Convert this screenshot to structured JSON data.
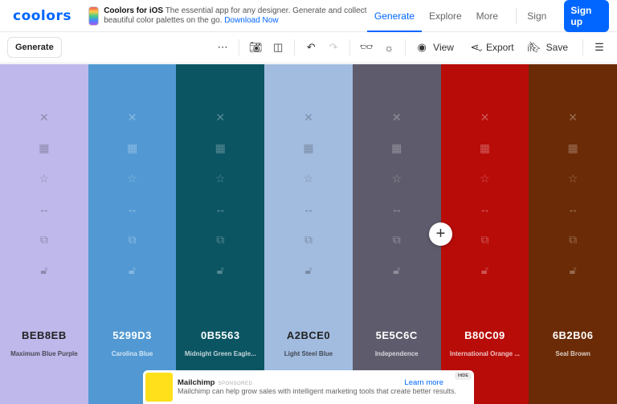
{
  "header": {
    "logo": "coolors",
    "promo_title": "Coolors for iOS",
    "promo_text": "The essential app for any designer. Generate and collect beautiful color palettes on the go.",
    "promo_link": "Download Now",
    "nav": [
      "Generate",
      "Explore",
      "More"
    ],
    "sign_in": "Sign in",
    "sign_up": "Sign up"
  },
  "toolbar": {
    "generate": "Generate",
    "view": "View",
    "export": "Export",
    "save": "Save"
  },
  "palette": [
    {
      "hex": "BEB8EB",
      "name": "Maximum Blue Purple",
      "color": "#BEB8EB",
      "text": "#222"
    },
    {
      "hex": "5299D3",
      "name": "Carolina Blue",
      "color": "#5299D3",
      "text": "#fff"
    },
    {
      "hex": "0B5563",
      "name": "Midnight Green Eagle...",
      "color": "#0B5563",
      "text": "#fff"
    },
    {
      "hex": "A2BCE0",
      "name": "Light Steel Blue",
      "color": "#A2BCE0",
      "text": "#222"
    },
    {
      "hex": "5E5C6C",
      "name": "Independence",
      "color": "#5E5C6C",
      "text": "#fff"
    },
    {
      "hex": "B80C09",
      "name": "International Orange ...",
      "color": "#B80C09",
      "text": "#fff"
    },
    {
      "hex": "6B2B06",
      "name": "Seal Brown",
      "color": "#6B2B06",
      "text": "#fff"
    }
  ],
  "ad": {
    "brand": "Mailchimp",
    "sponsored": "SPONSORED",
    "text": "Mailchimp can help grow sales with intelligent marketing tools that create better results.",
    "learn_more": "Learn more",
    "hide": "HIDE",
    "logo_text": "mailchimp"
  }
}
